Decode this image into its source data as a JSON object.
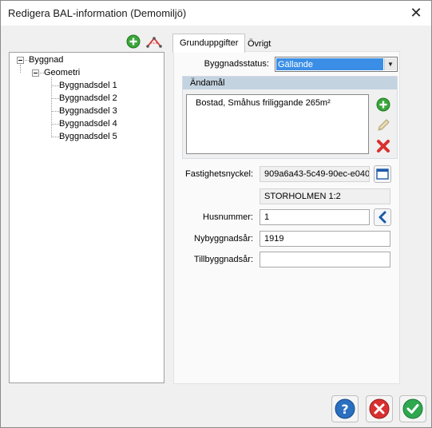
{
  "window": {
    "title": "Redigera BAL-information (Demomiljö)"
  },
  "toolbar": {
    "add_icon": "plus-circle-icon",
    "split_icon": "split-building-icon"
  },
  "tree": {
    "root": "Byggnad",
    "child": "Geometri",
    "leaves": [
      "Byggnadsdel 1",
      "Byggnadsdel 2",
      "Byggnadsdel 3",
      "Byggnadsdel 4",
      "Byggnadsdel 5"
    ]
  },
  "tabs": [
    {
      "label": "Grunduppgifter",
      "active": true
    },
    {
      "label": "Övrigt",
      "active": false
    }
  ],
  "form": {
    "byggnadsstatus_label": "Byggnadsstatus:",
    "byggnadsstatus_value": "Gällande",
    "andamal_header": "Ändamål",
    "andamal_items": [
      "Bostad, Småhus friliggande 265m²"
    ],
    "fastighetsnyckel_label": "Fastighetsnyckel:",
    "fastighetsnyckel_value": "909a6a43-5c49-90ec-e040",
    "fastighet_name": "STORHOLMEN 1:2",
    "husnummer_label": "Husnummer:",
    "husnummer_value": "1",
    "nybyggnadsar_label": "Nybyggnadsår:",
    "nybyggnadsar_value": "1919",
    "tillbyggnadsar_label": "Tillbyggnadsår:",
    "tillbyggnadsar_value": ""
  },
  "colors": {
    "accent": "#3a8ee6",
    "group_header": "#c4d3e0",
    "add_green": "#3aa63a",
    "delete_red": "#d93030",
    "ok_green": "#2fa84f",
    "help_blue": "#2a6fc0"
  }
}
